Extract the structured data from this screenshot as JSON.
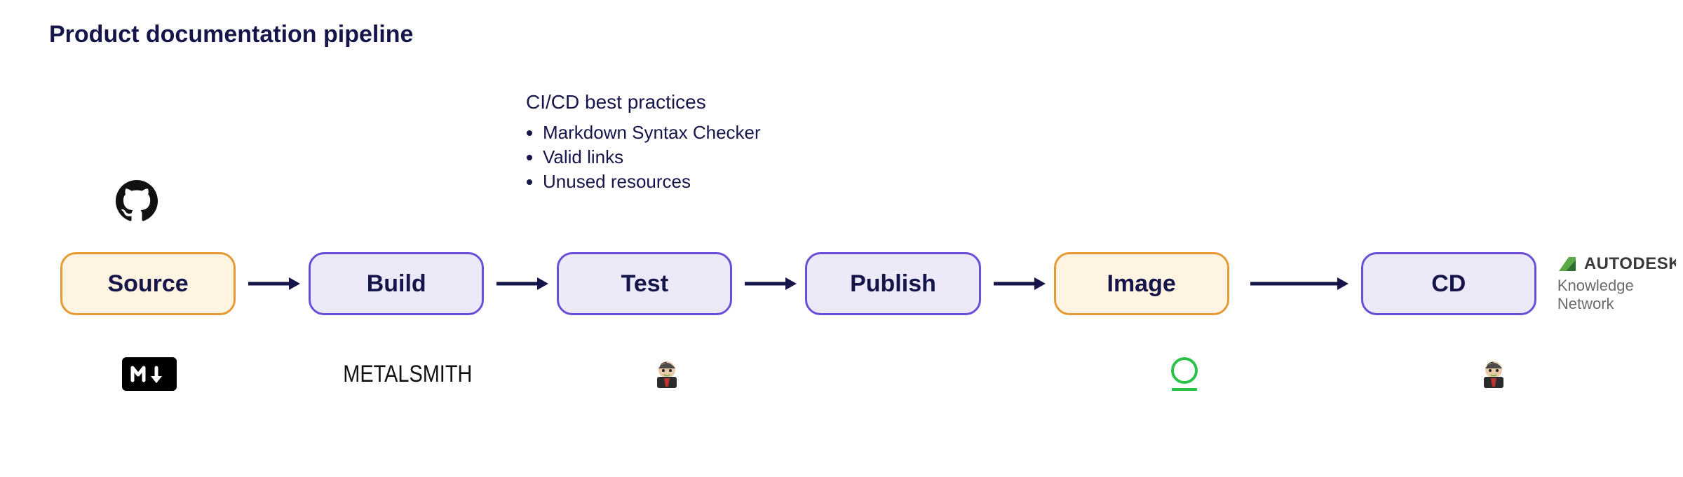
{
  "title": "Product documentation pipeline",
  "practices": {
    "heading": "CI/CD best practices",
    "items": [
      "Markdown Syntax Checker",
      "Valid links",
      "Unused resources"
    ]
  },
  "stages": [
    {
      "label": "Source",
      "style": "orange"
    },
    {
      "label": "Build",
      "style": "purple"
    },
    {
      "label": "Test",
      "style": "purple"
    },
    {
      "label": "Publish",
      "style": "purple"
    },
    {
      "label": "Image",
      "style": "orange"
    },
    {
      "label": "CD",
      "style": "purple"
    }
  ],
  "end_label": {
    "brand": "AUTODESK",
    "sub": "Knowledge Network"
  },
  "below_icons": {
    "source": "markdown",
    "build": "METALSMITH",
    "test": "jenkins",
    "image": "circle-underline",
    "cd": "jenkins"
  },
  "top_icon": "github"
}
